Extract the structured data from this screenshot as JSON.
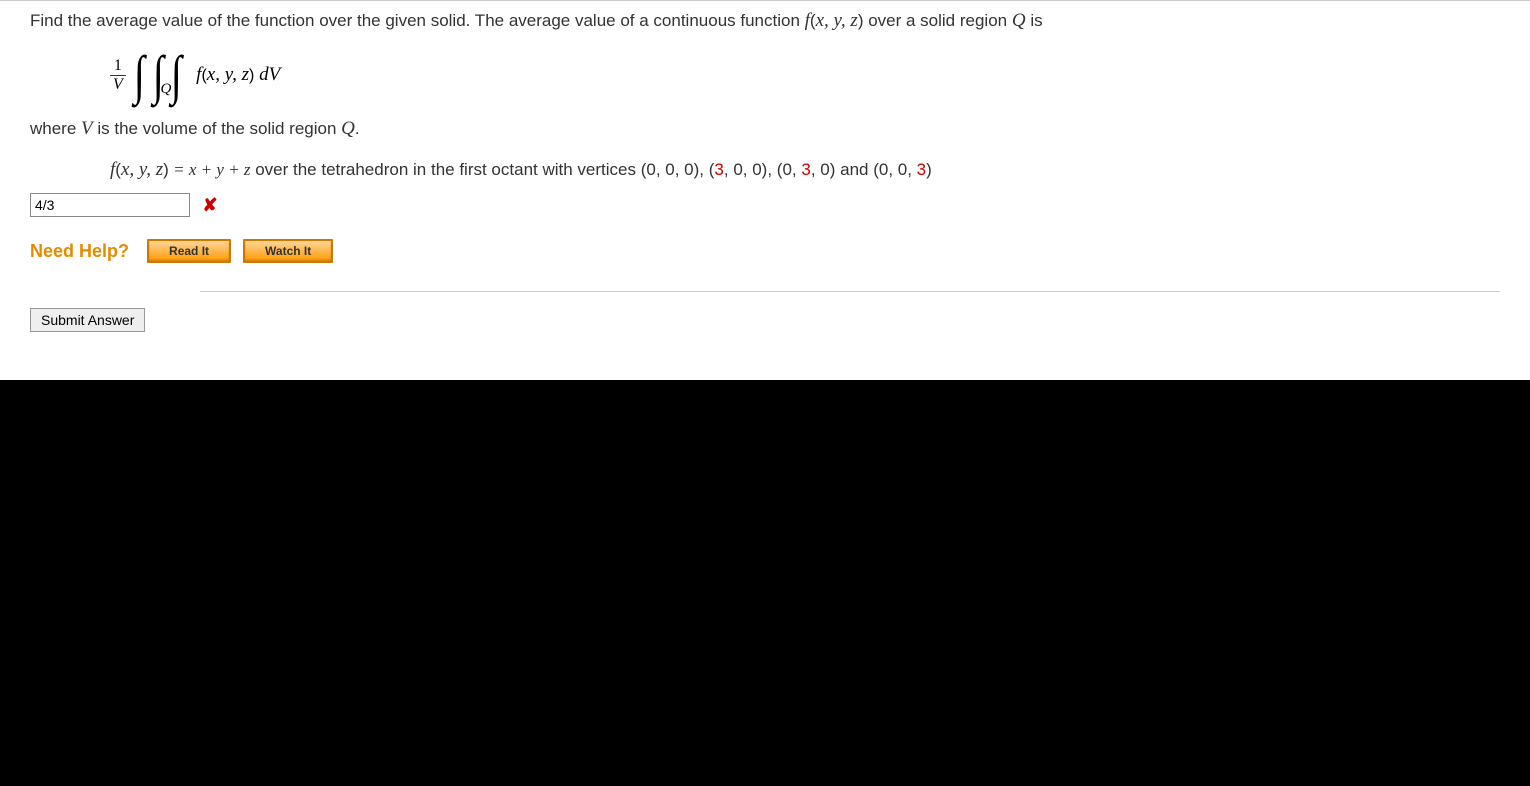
{
  "problem": {
    "intro_prefix": "Find the average value of the function over the given solid. The average value of a continuous function ",
    "fxyz": "f",
    "args": "x, y, z",
    "intro_suffix": " over a solid region ",
    "Q": "Q",
    "is": " is",
    "fraction_num": "1",
    "fraction_den": "V",
    "integrand_f": "f",
    "integrand_args": "x, y, z",
    "dV": " dV",
    "where_prefix": "where ",
    "V": "V",
    "where_mid": " is the volume of the solid region ",
    "where_Q": "Q",
    "period": ".",
    "eq_lhs_f": "f",
    "eq_lhs_args": "x, y, z",
    "eq_rhs": " = x + y + z",
    "eq_text": " over the tetrahedron in the first octant with vertices (0, 0, 0), (",
    "v1": "3",
    "eq_text2": ", 0, 0), (0, ",
    "v2": "3",
    "eq_text3": ", 0) and (0, 0, ",
    "v3": "3",
    "eq_text4": ")"
  },
  "answer": {
    "value": "4/3"
  },
  "help": {
    "label": "Need Help?",
    "read": "Read It",
    "watch": "Watch It"
  },
  "submit": {
    "label": "Submit Answer"
  }
}
